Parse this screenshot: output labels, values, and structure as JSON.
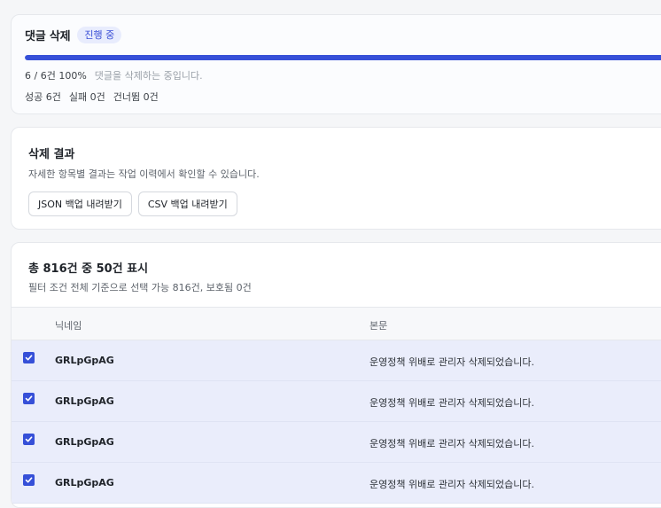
{
  "progress": {
    "title": "댓글 삭제",
    "badge": "진행 중",
    "fraction": 1.0,
    "count_text": "6 / 6건",
    "percent_text": "100%",
    "status_text": "댓글을 삭제하는 중입니다.",
    "success": "성공 6건",
    "failure": "실패 0건",
    "skipped": "건너뜀 0건"
  },
  "result": {
    "title": "삭제 결과",
    "description": "자세한 항목별 결과는 작업 이력에서 확인할 수 있습니다.",
    "json_button": "JSON 백업 내려받기",
    "csv_button": "CSV 백업 내려받기"
  },
  "table": {
    "title": "총 816건 중 50건 표시",
    "description": "필터 조건 전체 기준으로 선택 가능 816건, 보호됨 0건",
    "columns": {
      "nickname": "닉네임",
      "body": "본문"
    },
    "rows": [
      {
        "checked": true,
        "nickname": "GRLpGpAG",
        "body": "운영정책 위배로 관리자 삭제되었습니다."
      },
      {
        "checked": true,
        "nickname": "GRLpGpAG",
        "body": "운영정책 위배로 관리자 삭제되었습니다."
      },
      {
        "checked": true,
        "nickname": "GRLpGpAG",
        "body": "운영정책 위배로 관리자 삭제되었습니다."
      },
      {
        "checked": true,
        "nickname": "GRLpGpAG",
        "body": "운영정책 위배로 관리자 삭제되었습니다."
      }
    ]
  },
  "colors": {
    "accent": "#3650d8",
    "selected_row": "#eaedfb",
    "badge_bg": "#e8ecfd"
  },
  "icons": {
    "checkbox": "checkbox-checked-icon"
  }
}
